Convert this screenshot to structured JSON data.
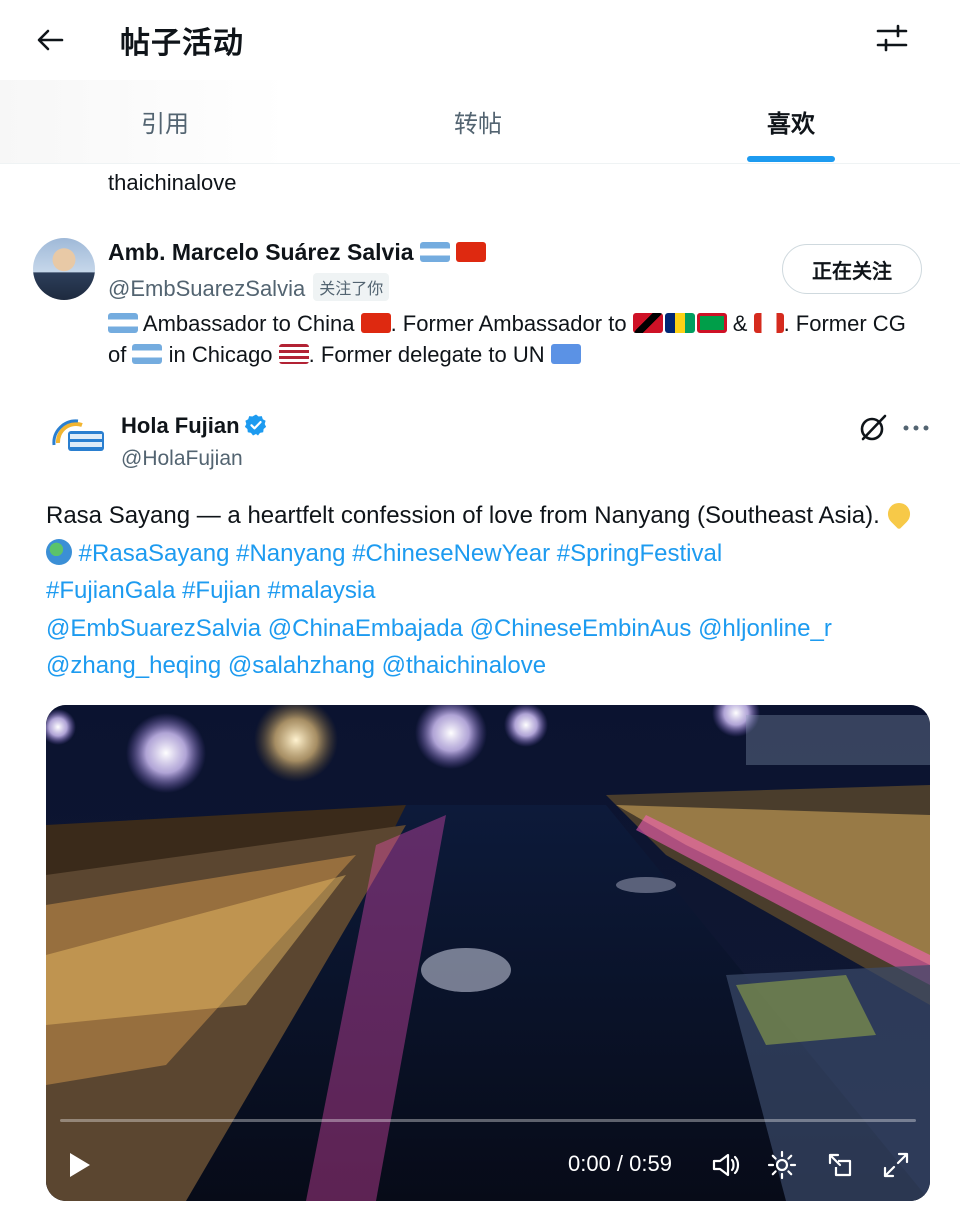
{
  "header": {
    "title": "帖子活动",
    "back_icon": "arrow-left-icon",
    "filter_icon": "sliders-icon"
  },
  "tabs": [
    {
      "label": "引用",
      "active": false
    },
    {
      "label": "转帖",
      "active": false
    },
    {
      "label": "喜欢",
      "active": true
    }
  ],
  "prev_user": {
    "name": "thaichinalove"
  },
  "user": {
    "name": "Amb. Marcelo Suárez Salvia",
    "handle": "@EmbSuarezSalvia",
    "follows_you": "关注了你",
    "follow_button": "正在关注",
    "bio": {
      "p1": " Ambassador to China ",
      "p2": ". Former Ambassador to ",
      "p3": " & ",
      "p4": ". Former CG of ",
      "p5": " in Chicago ",
      "p6": ". Former delegate to UN "
    }
  },
  "post": {
    "author_name": "Hola Fujian",
    "author_handle": "@HolaFujian",
    "text_plain": "Rasa Sayang — a heartfelt confession of love from Nanyang (Southeast Asia). ",
    "hashtags_line1": "#RasaSayang #Nanyang #ChineseNewYear #SpringFestival",
    "hashtags_line2": "#FujianGala #Fujian #malaysia",
    "mentions_line1": "@EmbSuarezSalvia @ChinaEmbajada @ChineseEmbinAus @hljonline_r",
    "mentions_line2": "@zhang_heqing @salahzhang @thaichinalove"
  },
  "video": {
    "time": "0:00 / 0:59",
    "progress": 0.0,
    "controls": [
      "play-icon",
      "volume-icon",
      "settings-icon",
      "pip-icon",
      "fullscreen-icon"
    ]
  },
  "colors": {
    "accent": "#1d9bf0",
    "text": "#0f1419",
    "secondary": "#536471"
  }
}
